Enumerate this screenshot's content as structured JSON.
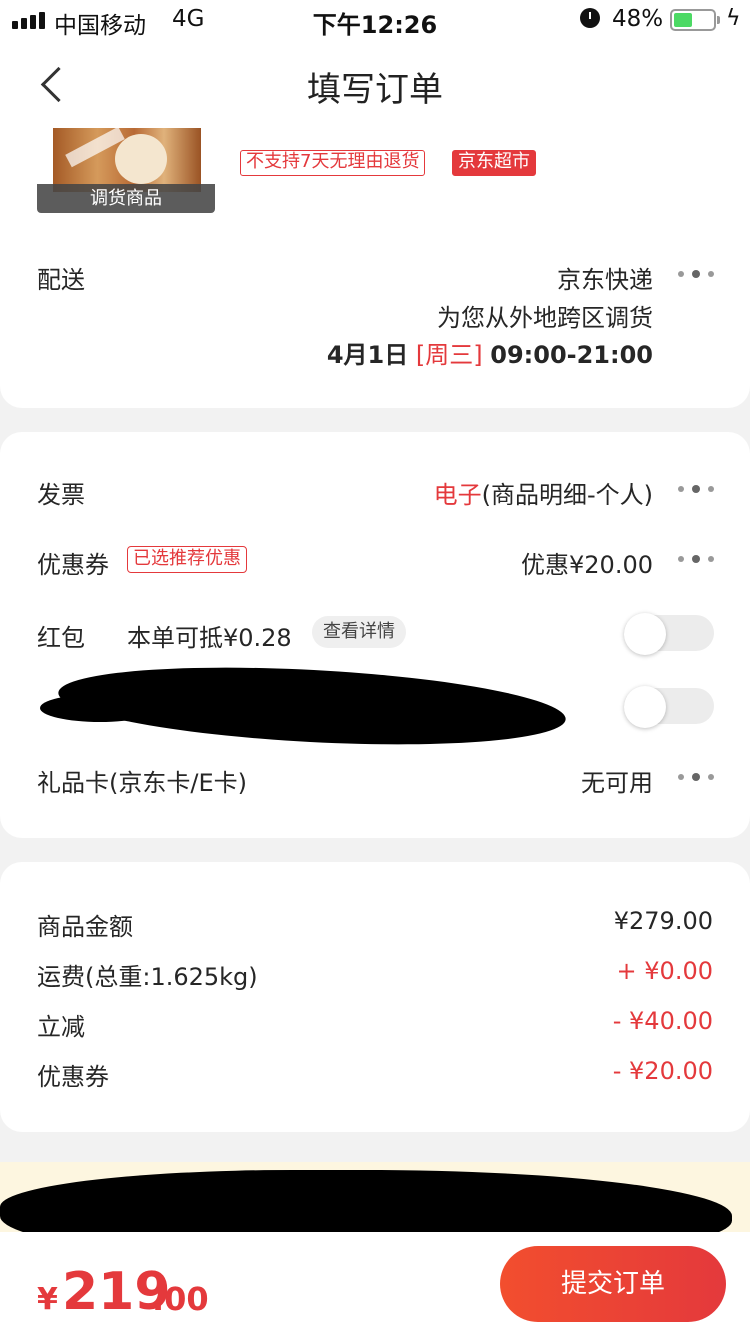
{
  "status_bar": {
    "carrier": "中国移动",
    "network": "4G",
    "time": "下午12:26",
    "battery_percent": "48%",
    "battery_level": 0.48
  },
  "nav": {
    "title": "填写订单"
  },
  "product": {
    "badge": "调货商品",
    "tags": [
      "不支持7天无理由退货",
      "京东超市"
    ]
  },
  "delivery": {
    "label": "配送",
    "carrier": "京东快递",
    "note": "为您从外地跨区调货",
    "date": "4月1日",
    "weekday": "[周三]",
    "time_range": "09:00-21:00"
  },
  "invoice": {
    "label": "发票",
    "type": "电子",
    "detail": "(商品明细-个人)"
  },
  "coupon": {
    "label": "优惠券",
    "tag": "已选推荐优惠",
    "value": "优惠¥20.00"
  },
  "red_packet": {
    "label": "红包",
    "desc": "本单可抵¥0.28",
    "detail_button": "查看详情",
    "enabled": false
  },
  "redacted_row": {
    "enabled": false
  },
  "gift_card": {
    "label": "礼品卡(京东卡/E卡)",
    "value": "无可用"
  },
  "summary": {
    "rows": [
      {
        "label": "商品金额",
        "value": "¥279.00"
      },
      {
        "label": "运费(总重:1.625kg)",
        "value": "+ ¥0.00"
      },
      {
        "label": "立减",
        "value": "- ¥40.00"
      },
      {
        "label": "优惠券",
        "value": "- ¥20.00"
      }
    ]
  },
  "footer": {
    "currency": "¥",
    "total_int": "219",
    "total_dec": ".00",
    "submit": "提交订单"
  },
  "colors": {
    "accent": "#e4393c",
    "background": "#f2f2f2",
    "card": "#ffffff"
  }
}
